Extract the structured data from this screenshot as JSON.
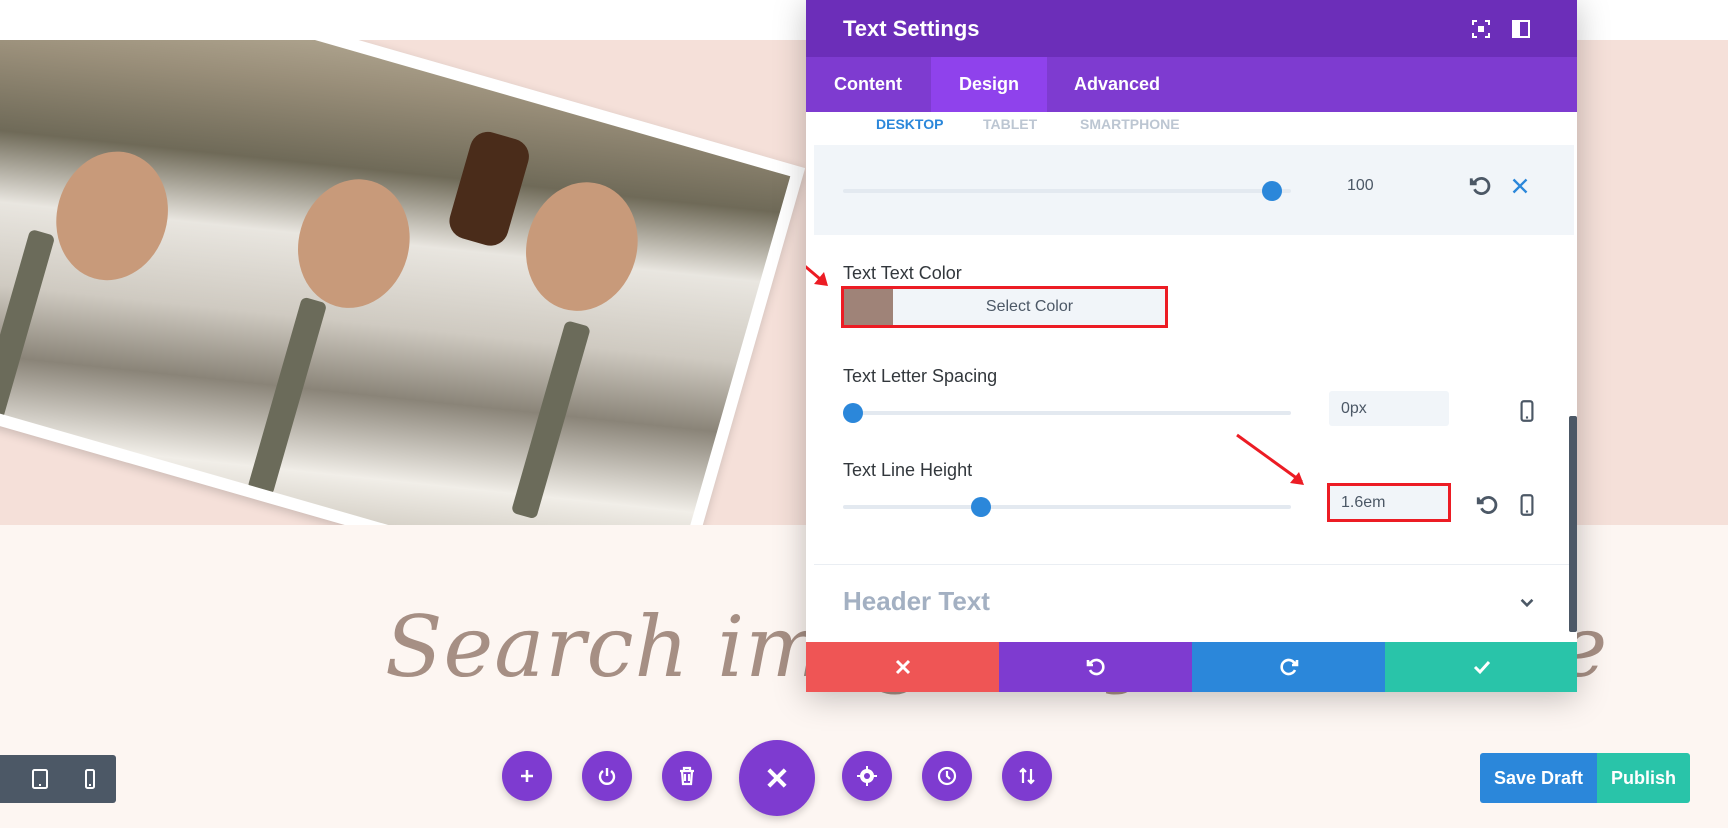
{
  "modal": {
    "title": "Text Settings",
    "tabs": [
      {
        "label": "Content"
      },
      {
        "label": "Design"
      },
      {
        "label": "Advanced"
      }
    ],
    "device_tabs": [
      {
        "label": "DESKTOP"
      },
      {
        "label": "TABLET"
      },
      {
        "label": "SMARTPHONE"
      }
    ],
    "opacity_value": "100",
    "opacity_level": 0.98,
    "text_color": {
      "label": "Text Text Color",
      "swatch": "#9f8378",
      "select_label": "Select Color"
    },
    "letter_spacing": {
      "label": "Text Letter Spacing",
      "value": "0px",
      "level": 0.0
    },
    "line_height": {
      "label": "Text Line Height",
      "value": "1.6em",
      "level": 0.3
    },
    "header_text_section": "Header Text"
  },
  "page": {
    "heading": "Search images by last name"
  },
  "bottom_bar": {
    "save_draft": "Save Draft",
    "publish": "Publish"
  },
  "colors": {
    "modal_header": "#6c2eb9",
    "modal_tabs": "#7e3bd0",
    "active_tab": "#8f42ec",
    "accent_blue": "#2b87da",
    "cancel_red": "#ef5555",
    "undo_purple": "#7e3bd0",
    "redo_blue": "#2b87da",
    "save_green": "#29c4a9",
    "annotation_red": "#ec1c24",
    "page_pink": "#f5e0d9"
  },
  "icons": {
    "header": [
      "fullscreen-icon",
      "split-view-icon"
    ],
    "footer": [
      "close-icon",
      "undo-icon",
      "redo-icon",
      "check-icon"
    ],
    "fabs": [
      "plus-icon",
      "power-icon",
      "trash-icon",
      "close-icon",
      "gear-icon",
      "history-icon",
      "sort-icon"
    ]
  }
}
